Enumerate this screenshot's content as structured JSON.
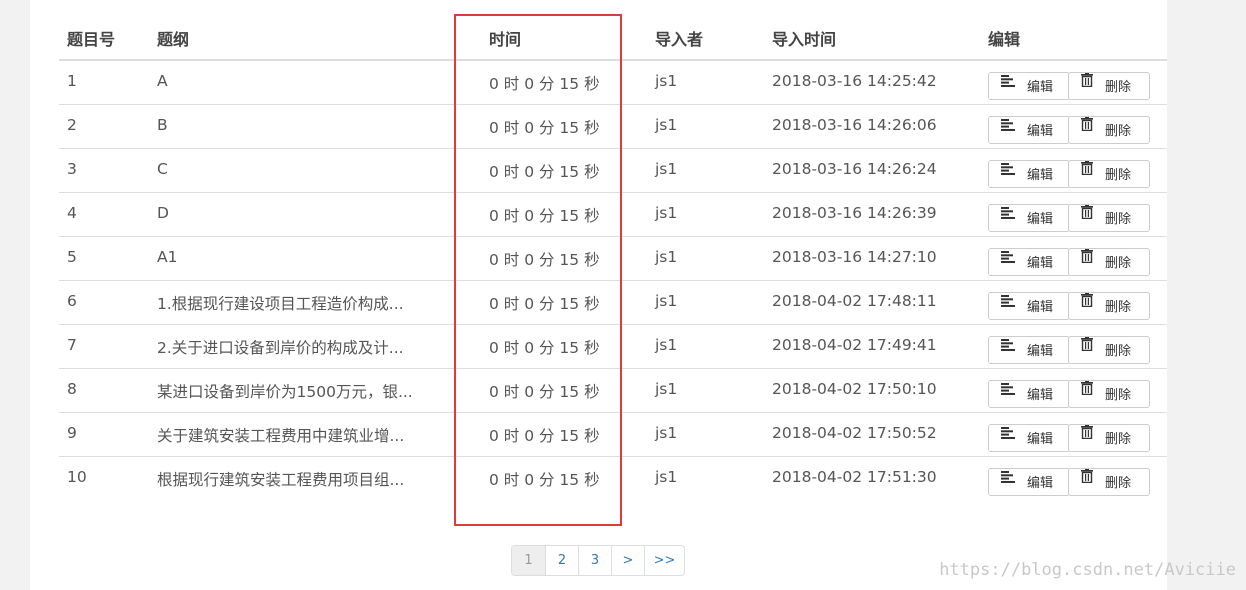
{
  "table": {
    "headers": {
      "no": "题目号",
      "title": "题纲",
      "time": "时间",
      "importer": "导入者",
      "import_time": "导入时间",
      "edit": "编辑"
    },
    "rows": [
      {
        "no": "1",
        "title": "A",
        "time": "0 时 0 分 15 秒",
        "importer": "js1",
        "import_time": "2018-03-16 14:25:42"
      },
      {
        "no": "2",
        "title": "B",
        "time": "0 时 0 分 15 秒",
        "importer": "js1",
        "import_time": "2018-03-16 14:26:06"
      },
      {
        "no": "3",
        "title": "C",
        "time": "0 时 0 分 15 秒",
        "importer": "js1",
        "import_time": "2018-03-16 14:26:24"
      },
      {
        "no": "4",
        "title": "D",
        "time": "0 时 0 分 15 秒",
        "importer": "js1",
        "import_time": "2018-03-16 14:26:39"
      },
      {
        "no": "5",
        "title": "A1",
        "time": "0 时 0 分 15 秒",
        "importer": "js1",
        "import_time": "2018-03-16 14:27:10"
      },
      {
        "no": "6",
        "title": "1.根据现行建设项目工程造价构成...",
        "time": "0 时 0 分 15 秒",
        "importer": "js1",
        "import_time": "2018-04-02 17:48:11"
      },
      {
        "no": "7",
        "title": "2.关于进口设备到岸价的构成及计...",
        "time": "0 时 0 分 15 秒",
        "importer": "js1",
        "import_time": "2018-04-02 17:49:41"
      },
      {
        "no": "8",
        "title": "某进口设备到岸价为1500万元，银...",
        "time": "0 时 0 分 15 秒",
        "importer": "js1",
        "import_time": "2018-04-02 17:50:10"
      },
      {
        "no": "9",
        "title": "关于建筑安装工程费用中建筑业增...",
        "time": "0 时 0 分 15 秒",
        "importer": "js1",
        "import_time": "2018-04-02 17:50:52"
      },
      {
        "no": "10",
        "title": "根据现行建筑安装工程费用项目组...",
        "time": "0 时 0 分 15 秒",
        "importer": "js1",
        "import_time": "2018-04-02 17:51:30"
      }
    ],
    "edit_button_label": "编辑",
    "delete_button_label": "删除",
    "edit_icon": "align-left-icon",
    "delete_icon": "trash-icon"
  },
  "pagination": {
    "pages": [
      "1",
      "2",
      "3"
    ],
    "current": "1",
    "next": ">",
    "last": ">>"
  },
  "highlight_color": "#e03b3b",
  "watermark": "https://blog.csdn.net/Aviciie"
}
